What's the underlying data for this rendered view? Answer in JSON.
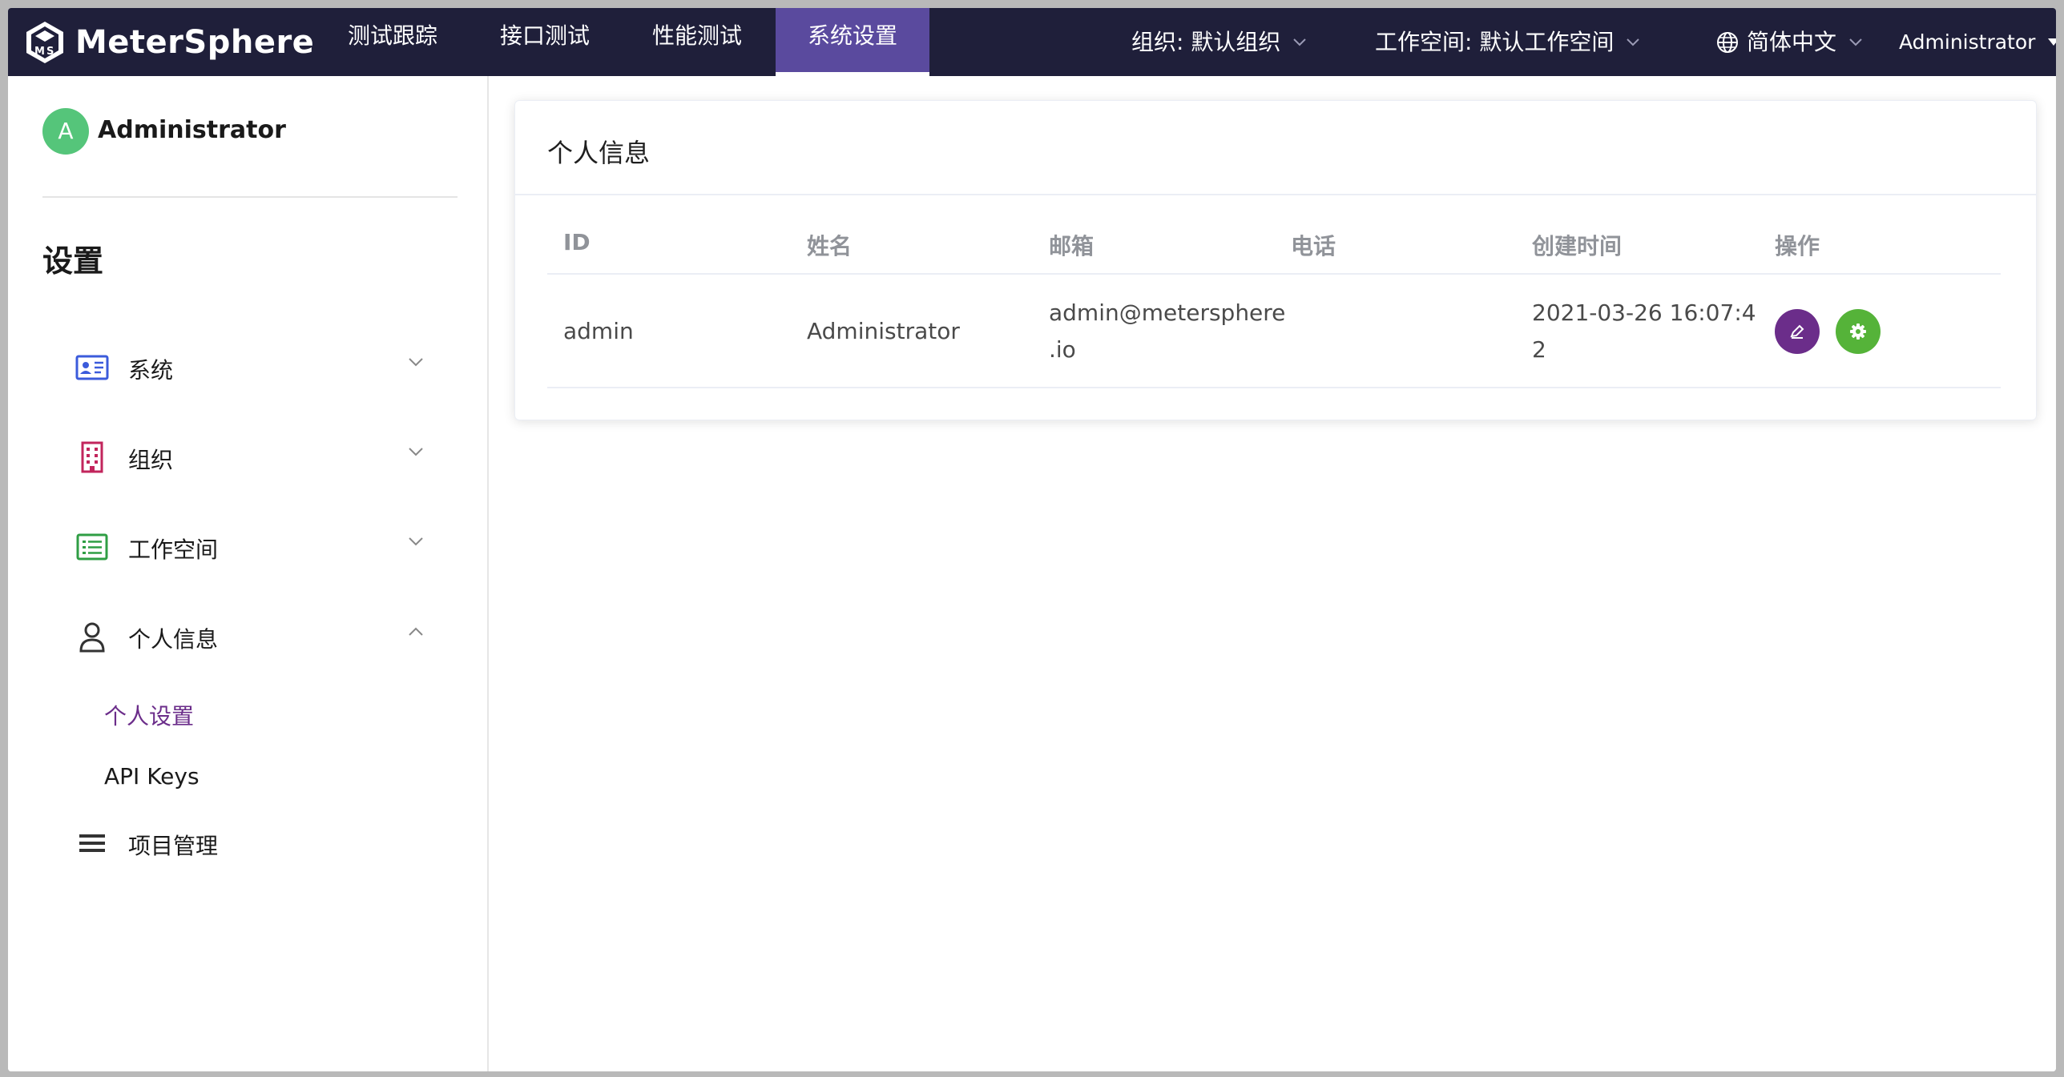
{
  "header": {
    "logo_text": "MeterSphere",
    "nav_tabs": [
      {
        "label": "测试跟踪"
      },
      {
        "label": "接口测试"
      },
      {
        "label": "性能测试"
      },
      {
        "label": "系统设置",
        "active": true
      }
    ],
    "org_dropdown": "组织: 默认组织",
    "workspace_dropdown": "工作空间: 默认工作空间",
    "language_dropdown": "简体中文",
    "user_dropdown": "Administrator",
    "bg_color": "#1f1f3a",
    "active_tab_color": "#5a4a9e"
  },
  "sidebar": {
    "avatar_letter": "A",
    "user_name": "Administrator",
    "title": "设置",
    "items": [
      {
        "label": "系统",
        "icon": "id-card-icon"
      },
      {
        "label": "组织",
        "icon": "building-icon"
      },
      {
        "label": "工作空间",
        "icon": "list-icon"
      },
      {
        "label": "个人信息",
        "icon": "user-icon",
        "expanded": true
      },
      {
        "label": "项目管理",
        "icon": "menu-lines-icon"
      }
    ],
    "sub_items": [
      {
        "label": "个人设置",
        "active": true
      },
      {
        "label": "API Keys"
      }
    ],
    "active_color": "#6b2d8a"
  },
  "main": {
    "card_title": "个人信息",
    "columns": [
      "ID",
      "姓名",
      "邮箱",
      "电话",
      "创建时间",
      "操作"
    ],
    "rows": [
      {
        "id": "admin",
        "name": "Administrator",
        "email_line1": "admin@metersphere",
        "email_line2": ".io",
        "phone": "",
        "created_line1": "2021-03-26 16:07:4",
        "created_line2": "2",
        "actions": [
          "edit-icon",
          "settings-icon"
        ]
      }
    ],
    "edit_btn_color": "#6b2d8a",
    "settings_btn_color": "#55b339"
  }
}
